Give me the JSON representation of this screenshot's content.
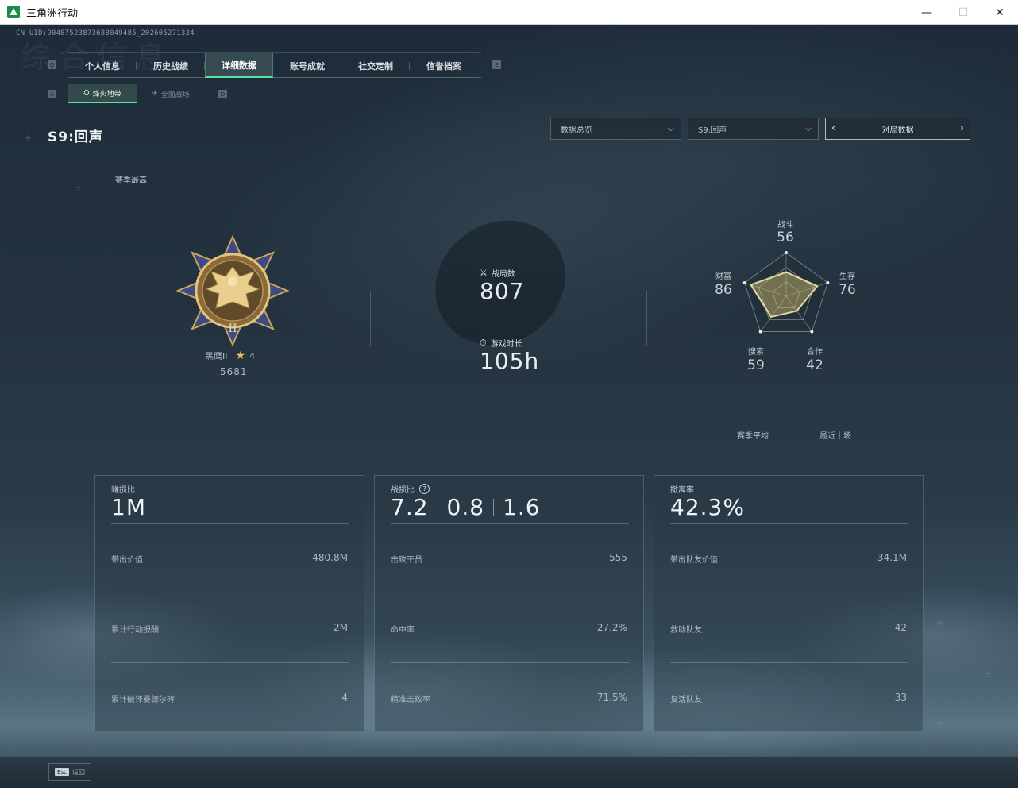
{
  "window": {
    "title": "三角洲行动",
    "minimize": "—",
    "maximize": "☐",
    "close": "✕"
  },
  "header": {
    "uid": "CN UID:9048752387368804948​5_202605271334",
    "watermark": "综合信息"
  },
  "key_hints": {
    "tabs_left": "Q",
    "tabs_right": "E",
    "sub_left": "A",
    "sub_right": "D"
  },
  "tabs": [
    {
      "label": "个人信息"
    },
    {
      "label": "历史战绩"
    },
    {
      "label": "详细数据"
    },
    {
      "label": "账号成就"
    },
    {
      "label": "社交定制"
    },
    {
      "label": "信誉档案"
    }
  ],
  "subtabs": [
    {
      "label": "烽火地带",
      "icon": "fire-zone-icon",
      "glyph": "⛭"
    },
    {
      "label": "全面战场",
      "icon": "battlefield-icon",
      "glyph": "✈"
    }
  ],
  "season_title": "S9:回声",
  "filters": {
    "overview": "数据总览",
    "season": "S9:回声",
    "match_data": "对局数据",
    "prev": "‹",
    "next": "›",
    "chev": "⌵"
  },
  "season_best": "赛季最高",
  "rank": {
    "name": "黑鹰II",
    "stars": "4",
    "score": "5681",
    "star_glyph": "★"
  },
  "stats": {
    "matches_label": "战局数",
    "matches_icon": "⚔",
    "matches_value": "807",
    "playtime_label": "游戏时长",
    "playtime_icon": "⏱",
    "playtime_value": "105h"
  },
  "radar": {
    "labels": {
      "combat": "战斗",
      "survival": "生存",
      "teamwork": "合作",
      "search": "搜索",
      "wealth": "财富"
    },
    "values": {
      "combat": 56,
      "survival": 76,
      "teamwork": 42,
      "search": 59,
      "wealth": 86
    },
    "colors": {
      "season_avg": "#dfe4e8",
      "recent_ten": "#e6c25a"
    }
  },
  "legend": {
    "season_avg": "赛季平均",
    "recent_ten": "最近十场"
  },
  "cards": [
    {
      "title": "赚损比",
      "big": "1M",
      "rows": [
        {
          "label": "带出价值",
          "value": "480.8M"
        },
        {
          "label": "累计行动报酬",
          "value": "2M"
        },
        {
          "label": "累计破译曼德尔砖",
          "value": "4"
        }
      ]
    },
    {
      "title": "战损比",
      "help": "?",
      "big_parts": [
        "7.2",
        "0.8",
        "1.6"
      ],
      "rows": [
        {
          "label": "击败干员",
          "value": "555"
        },
        {
          "label": "命中率",
          "value": "27.2%"
        },
        {
          "label": "精准击败率",
          "value": "71.5%"
        }
      ]
    },
    {
      "title": "撤离率",
      "big": "42.3%",
      "rows": [
        {
          "label": "带出队友价值",
          "value": "34.1M"
        },
        {
          "label": "救助队友",
          "value": "42"
        },
        {
          "label": "复活队友",
          "value": "33"
        }
      ]
    }
  ],
  "footer": {
    "esc_key": "Esc",
    "esc_label": "返回"
  }
}
